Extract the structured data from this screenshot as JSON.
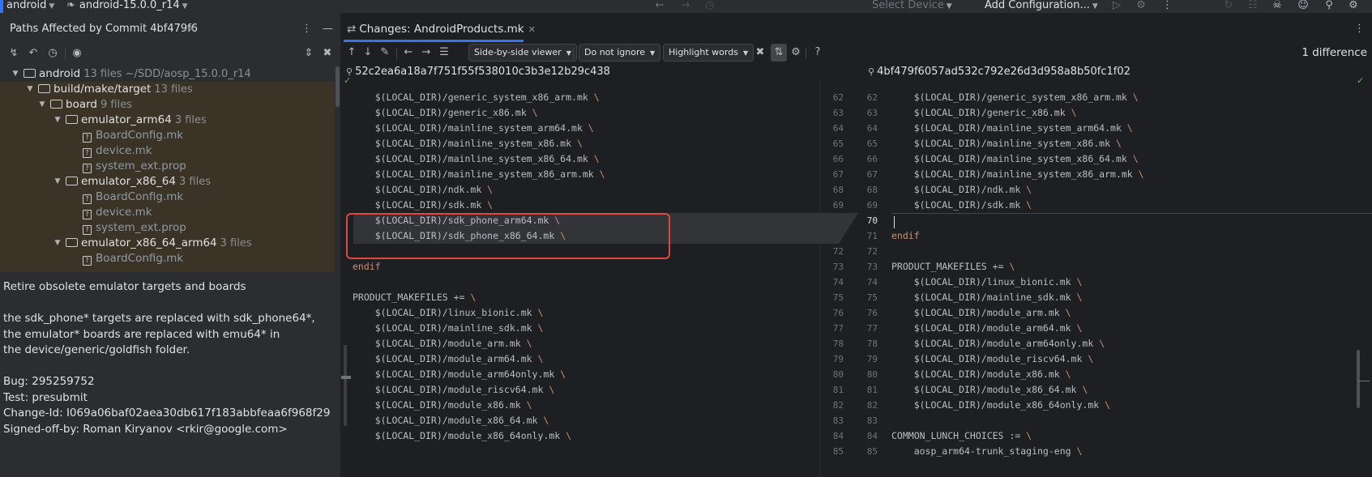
{
  "topbar": {
    "project": "android",
    "branch": "android-15.0.0_r14",
    "device": "Select Device",
    "config": "Add Configuration..."
  },
  "left": {
    "title": "Paths Affected by Commit 4bf479f6",
    "tree": [
      {
        "label": "android",
        "count": "13 files ~/SDD/aosp_15.0.0_r14",
        "type": "folder"
      },
      {
        "label": "build/make/target",
        "count": "13 files",
        "type": "folder"
      },
      {
        "label": "board",
        "count": "9 files",
        "type": "folder"
      },
      {
        "label": "emulator_arm64",
        "count": "3 files",
        "type": "folder"
      },
      {
        "label": "BoardConfig.mk",
        "type": "file"
      },
      {
        "label": "device.mk",
        "type": "file"
      },
      {
        "label": "system_ext.prop",
        "type": "file"
      },
      {
        "label": "emulator_x86_64",
        "count": "3 files",
        "type": "folder"
      },
      {
        "label": "BoardConfig.mk",
        "type": "file"
      },
      {
        "label": "device.mk",
        "type": "file"
      },
      {
        "label": "system_ext.prop",
        "type": "file"
      },
      {
        "label": "emulator_x86_64_arm64",
        "count": "3 files",
        "type": "folder"
      },
      {
        "label": "BoardConfig.mk",
        "type": "file"
      }
    ],
    "commit_message": [
      "Retire obsolete emulator targets and boards",
      "",
      "the sdk_phone* targets are replaced with sdk_phone64*,",
      "the emulator* boards are replaced with emu64* in",
      "the device/generic/goldfish folder.",
      "",
      "Bug: 295259752",
      "Test: presubmit",
      "Change-Id: I069a06baf02aea30db617f183abbfeaa6f968f29",
      "Signed-off-by: Roman Kiryanov <rkir@google.com>"
    ]
  },
  "diff": {
    "tab_title": "Changes: AndroidProducts.mk",
    "viewer_mode": "Side-by-side viewer",
    "ignore_mode": "Do not ignore",
    "highlight_mode": "Highlight words",
    "difference_count": "1 difference",
    "left_hash": "52c2ea6a18a7f751f55f538010c3b3e12b29c438",
    "right_hash": "4bf479f6057ad532c792e26d3d958a8b50fc1f02",
    "left_lines": [
      {
        "text": "    $(LOCAL_DIR)/generic_system_x86_arm.mk ",
        "bs": true
      },
      {
        "text": "    $(LOCAL_DIR)/generic_x86.mk ",
        "bs": true
      },
      {
        "text": "    $(LOCAL_DIR)/mainline_system_arm64.mk ",
        "bs": true
      },
      {
        "text": "    $(LOCAL_DIR)/mainline_system_x86.mk ",
        "bs": true
      },
      {
        "text": "    $(LOCAL_DIR)/mainline_system_x86_64.mk ",
        "bs": true
      },
      {
        "text": "    $(LOCAL_DIR)/mainline_system_x86_arm.mk ",
        "bs": true
      },
      {
        "text": "    $(LOCAL_DIR)/ndk.mk ",
        "bs": true
      },
      {
        "text": "    $(LOCAL_DIR)/sdk.mk ",
        "bs": true
      },
      {
        "text": "    $(LOCAL_DIR)/sdk_phone_arm64.mk ",
        "bs": true
      },
      {
        "text": "    $(LOCAL_DIR)/sdk_phone_x86_64.mk ",
        "bs": true
      },
      {
        "text": "",
        "bs": false
      },
      {
        "text": "endif",
        "kw": true
      },
      {
        "text": "",
        "bs": false
      },
      {
        "text": "PRODUCT_MAKEFILES += ",
        "bs": true
      },
      {
        "text": "    $(LOCAL_DIR)/linux_bionic.mk ",
        "bs": true
      },
      {
        "text": "    $(LOCAL_DIR)/mainline_sdk.mk ",
        "bs": true
      },
      {
        "text": "    $(LOCAL_DIR)/module_arm.mk ",
        "bs": true
      },
      {
        "text": "    $(LOCAL_DIR)/module_arm64.mk ",
        "bs": true
      },
      {
        "text": "    $(LOCAL_DIR)/module_arm64only.mk ",
        "bs": true
      },
      {
        "text": "    $(LOCAL_DIR)/module_riscv64.mk ",
        "bs": true
      },
      {
        "text": "    $(LOCAL_DIR)/module_x86.mk ",
        "bs": true
      },
      {
        "text": "    $(LOCAL_DIR)/module_x86_64.mk ",
        "bs": true
      },
      {
        "text": "    $(LOCAL_DIR)/module_x86_64only.mk ",
        "bs": true
      }
    ],
    "left_numbers": [
      "62",
      "63",
      "64",
      "65",
      "66",
      "67",
      "68",
      "69",
      "70",
      "",
      "72",
      "73",
      "74",
      "75",
      "76",
      "77",
      "78",
      "79",
      "80",
      "81",
      "82",
      "83",
      "84",
      "85"
    ],
    "right_numbers": [
      "62",
      "63",
      "64",
      "65",
      "66",
      "67",
      "68",
      "69",
      "70",
      "71",
      "72",
      "73",
      "74",
      "75",
      "76",
      "77",
      "78",
      "79",
      "80",
      "81",
      "82",
      "83",
      "84",
      "85"
    ],
    "right_lines": [
      {
        "text": "    $(LOCAL_DIR)/generic_system_x86_arm.mk ",
        "bs": true
      },
      {
        "text": "    $(LOCAL_DIR)/generic_x86.mk ",
        "bs": true
      },
      {
        "text": "    $(LOCAL_DIR)/mainline_system_arm64.mk ",
        "bs": true
      },
      {
        "text": "    $(LOCAL_DIR)/mainline_system_x86.mk ",
        "bs": true
      },
      {
        "text": "    $(LOCAL_DIR)/mainline_system_x86_64.mk ",
        "bs": true
      },
      {
        "text": "    $(LOCAL_DIR)/mainline_system_x86_arm.mk ",
        "bs": true
      },
      {
        "text": "    $(LOCAL_DIR)/ndk.mk ",
        "bs": true
      },
      {
        "text": "    $(LOCAL_DIR)/sdk.mk ",
        "bs": true
      },
      {
        "text": "",
        "bs": false
      },
      {
        "text": "endif",
        "kw": true
      },
      {
        "text": "",
        "bs": false
      },
      {
        "text": "PRODUCT_MAKEFILES += ",
        "bs": true
      },
      {
        "text": "    $(LOCAL_DIR)/linux_bionic.mk ",
        "bs": true
      },
      {
        "text": "    $(LOCAL_DIR)/mainline_sdk.mk ",
        "bs": true
      },
      {
        "text": "    $(LOCAL_DIR)/module_arm.mk ",
        "bs": true
      },
      {
        "text": "    $(LOCAL_DIR)/module_arm64.mk ",
        "bs": true
      },
      {
        "text": "    $(LOCAL_DIR)/module_arm64only.mk ",
        "bs": true
      },
      {
        "text": "    $(LOCAL_DIR)/module_riscv64.mk ",
        "bs": true
      },
      {
        "text": "    $(LOCAL_DIR)/module_x86.mk ",
        "bs": true
      },
      {
        "text": "    $(LOCAL_DIR)/module_x86_64.mk ",
        "bs": true
      },
      {
        "text": "    $(LOCAL_DIR)/module_x86_64only.mk ",
        "bs": true
      },
      {
        "text": "",
        "bs": false
      },
      {
        "text": "COMMON_LUNCH_CHOICES := ",
        "bs": true
      },
      {
        "text": "    aosp_arm64-trunk_staging-eng ",
        "bs": true
      }
    ]
  },
  "colors": {
    "accent": "#3574f0",
    "highlight_box": "#e2463f",
    "tree_bg": "#3b3325"
  }
}
